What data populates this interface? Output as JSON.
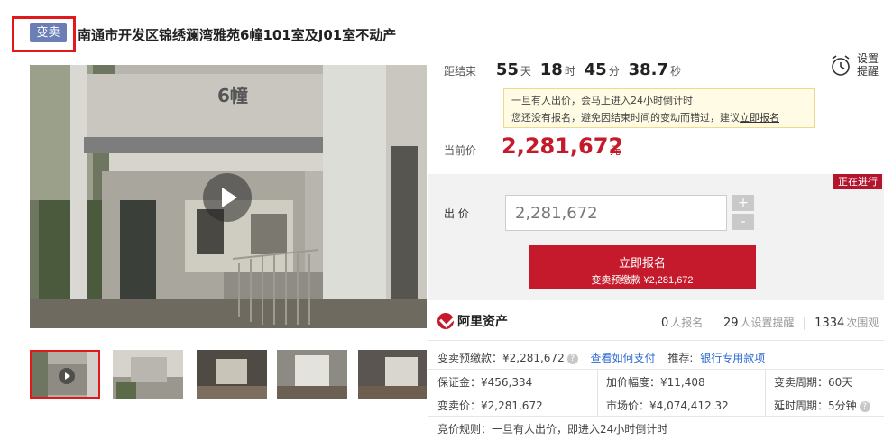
{
  "header": {
    "tag": "变卖",
    "title": "南通市开发区锦绣澜湾雅苑6幢101室及J01室不动产"
  },
  "photo": {
    "building_sign": "6幢"
  },
  "countdown": {
    "label": "距结束",
    "days": "55",
    "days_unit": "天",
    "hours": "18",
    "hours_unit": "时",
    "minutes": "45",
    "minutes_unit": "分",
    "seconds": "38.7",
    "seconds_unit": "秒"
  },
  "reminder": {
    "line1": "设置",
    "line2": "提醒"
  },
  "notice": {
    "line1": "一旦有人出价，会马上进入24小时倒计时",
    "line2_prefix": "您还没有报名，避免因结束时间的变动而错过，建议",
    "line2_link": "立即报名"
  },
  "price": {
    "label": "当前价",
    "value": "2,281,672",
    "unit": "元"
  },
  "bid": {
    "status": "正在进行",
    "label": "出 价",
    "input_value": "2,281,672",
    "plus": "+",
    "minus": "-",
    "register_label": "立即报名",
    "register_sub": "变卖预缴款 ¥2,281,672"
  },
  "brand": {
    "name": "阿里资产"
  },
  "stats": {
    "registered": "0",
    "registered_label": "人报名",
    "reminders": "29",
    "reminders_label": "人设置提醒",
    "views": "1334",
    "views_label": "次围观"
  },
  "details": {
    "deposit_pay_label": "变卖预缴款：¥2,281,672",
    "how_to_pay": "查看如何支付",
    "recommend_label": "推荐:",
    "bank_loan": "银行专用款项",
    "margin": "保证金：¥456,334",
    "increment": "加价幅度：¥11,408",
    "sale_period": "变卖周期：60天",
    "sale_price": "变卖价：¥2,281,672",
    "market_price": "市场价：¥4,074,412.32",
    "extension": "延时周期：5分钟",
    "rule": "竞价规则：一旦有人出价，即进入24小时倒计时"
  },
  "colors": {
    "accent_red": "#c41a2b",
    "tag_blue": "#6b7fb6",
    "link_blue": "#2e6bd1",
    "highlight_box": "#e0191c"
  }
}
